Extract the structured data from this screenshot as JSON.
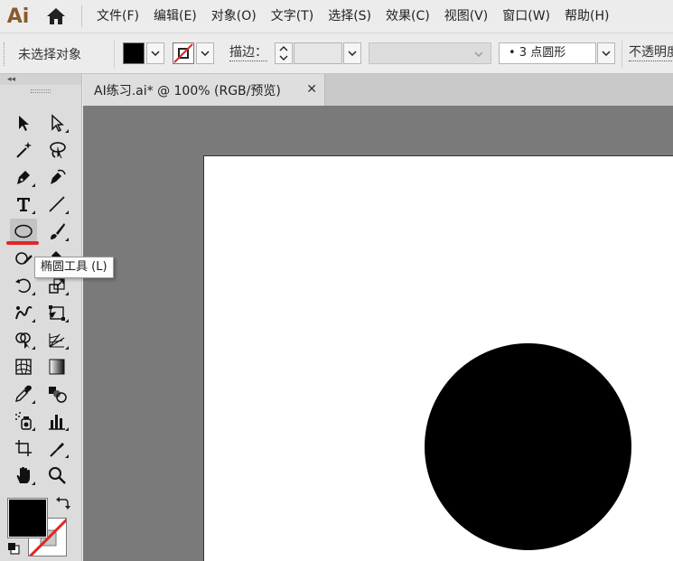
{
  "app": {
    "logo": "Ai"
  },
  "menu": [
    "文件(F)",
    "编辑(E)",
    "对象(O)",
    "文字(T)",
    "选择(S)",
    "效果(C)",
    "视图(V)",
    "窗口(W)",
    "帮助(H)"
  ],
  "control_bar": {
    "selection_status": "未选择对象",
    "stroke_label": "描边：",
    "brush_value": "• 3 点圆形",
    "opacity_label": "不透明度"
  },
  "toolbar": {
    "tooltip": "椭圆工具 (L)",
    "active_tool": "ellipse-tool",
    "fill_color": "#000000",
    "stroke_color": "none"
  },
  "document": {
    "tab_title": "AI练习.ai* @ 100% (RGB/预览)",
    "close_glyph": "✕"
  },
  "colors": {
    "accent_red": "#e0262a",
    "canvas_gray": "#7a7a7a"
  }
}
